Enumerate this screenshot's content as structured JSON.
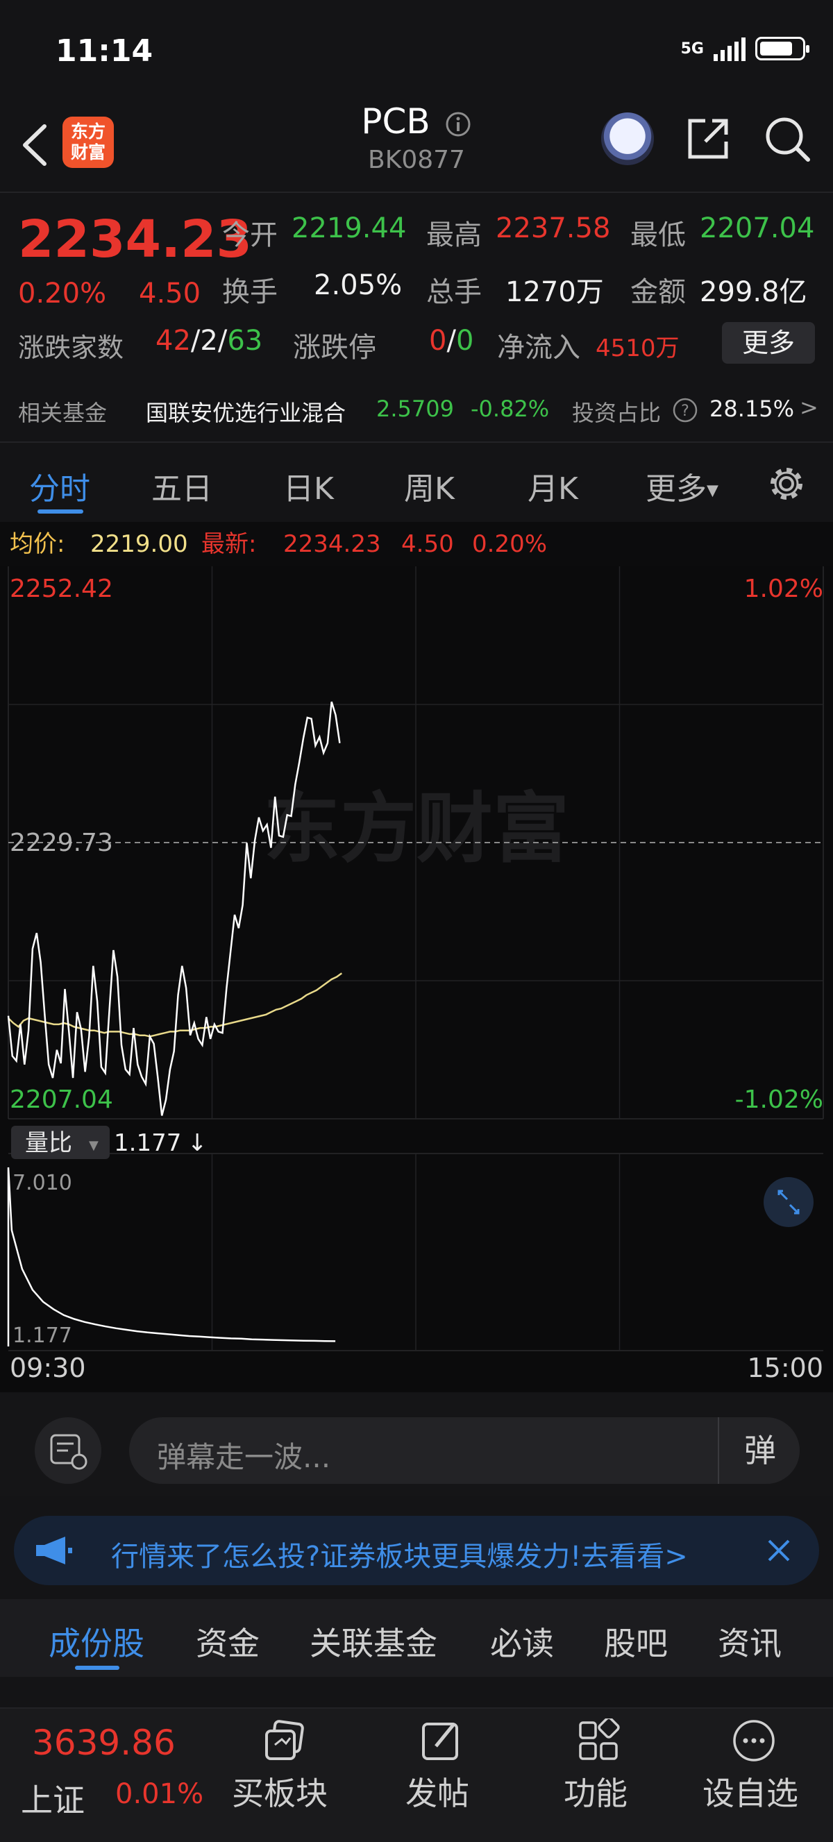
{
  "status": {
    "time": "11:14",
    "network": "5G"
  },
  "header": {
    "logo_text": "东方财富",
    "title": "PCB",
    "subtitle": "BK0877"
  },
  "quote": {
    "price": "2234.23",
    "change_pct": "0.20%",
    "change": "4.50",
    "open_label": "今开",
    "open": "2219.44",
    "high_label": "最高",
    "high": "2237.58",
    "low_label": "最低",
    "low": "2207.04",
    "turnover_label": "换手",
    "turnover": "2.05%",
    "volume_label": "总手",
    "volume": "1270万",
    "amount_label": "金额",
    "amount": "299.8亿",
    "breadth_label": "涨跌家数",
    "breadth_up": "42",
    "breadth_flat": "2",
    "breadth_down": "63",
    "limit_label": "涨跌停",
    "limit_up": "0",
    "limit_down": "0",
    "inflow_label": "净流入",
    "inflow": "4510万",
    "more_label": "更多"
  },
  "fund": {
    "label": "相关基金",
    "name": "国联安优选行业混合",
    "nav": "2.5709",
    "change": "-0.82%",
    "ratio_label": "投资占比",
    "ratio": "28.15%",
    "arrow": ">"
  },
  "tabs": [
    "分时",
    "五日",
    "日K",
    "周K",
    "月K",
    "更多"
  ],
  "avg_row": {
    "avg_label": "均价:",
    "avg": "2219.00",
    "latest_label": "最新:",
    "latest": "2234.23",
    "change": "4.50",
    "change_pct": "0.20%"
  },
  "chart_data": {
    "type": "line",
    "price_axis": {
      "max": "2252.42",
      "mid": "2229.73",
      "min": "2207.04",
      "max_pct": "1.02%",
      "min_pct": "-1.02%"
    },
    "ylim": [
      2207.04,
      2252.42
    ],
    "watermark": "东方财富",
    "series": [
      {
        "name": "最新",
        "values": [
          2215.5,
          2212.2,
          2211.8,
          2214.8,
          2211.5,
          2214.3,
          2221.0,
          2222.3,
          2219.9,
          2215.6,
          2211.5,
          2210.4,
          2212.7,
          2211.6,
          2217.7,
          2214.2,
          2210.4,
          2215.8,
          2214.4,
          2210.9,
          2213.8,
          2219.6,
          2216.7,
          2211.3,
          2210.8,
          2215.9,
          2220.9,
          2218.7,
          2213.1,
          2211.1,
          2210.7,
          2214.5,
          2211.5,
          2210.5,
          2209.9,
          2213.8,
          2213.2,
          2210.4,
          2207.3,
          2208.6,
          2211.1,
          2212.6,
          2217.2,
          2219.6,
          2217.8,
          2213.9,
          2214.9,
          2213.6,
          2213.1,
          2215.4,
          2213.6,
          2214.8,
          2214.2,
          2214.1,
          2217.8,
          2220.8,
          2223.8,
          2222.7,
          2224.6,
          2229.7,
          2226.8,
          2229.9,
          2231.8,
          2230.7,
          2231.2,
          2229.3,
          2233.5,
          2230.3,
          2230.2,
          2232.0,
          2231.9,
          2234.5,
          2236.3,
          2238.3,
          2240.0,
          2239.9,
          2237.7,
          2238.4,
          2237.1,
          2237.9,
          2241.3,
          2240.2,
          2237.9
        ]
      },
      {
        "name": "均价",
        "values": [
          2215.3,
          2214.9,
          2214.6,
          2215.1,
          2215.3,
          2215.2,
          2215.1,
          2215.0,
          2214.9,
          2214.8,
          2214.8,
          2214.9,
          2214.8,
          2214.6,
          2214.5,
          2214.4,
          2214.3,
          2214.3,
          2214.2,
          2214.1,
          2214.2,
          2214.2,
          2214.2,
          2214.1,
          2214.0,
          2214.0,
          2213.9,
          2213.9,
          2213.8,
          2213.9,
          2214.0,
          2214.1,
          2214.2,
          2214.2,
          2214.3,
          2214.3,
          2214.3,
          2214.4,
          2214.5,
          2214.5,
          2214.6,
          2214.6,
          2214.7,
          2214.8,
          2214.9,
          2215.0,
          2215.1,
          2215.2,
          2215.3,
          2215.4,
          2215.5,
          2215.6,
          2215.8,
          2216.0,
          2216.1,
          2216.3,
          2216.5,
          2216.7,
          2216.9,
          2217.2,
          2217.4,
          2217.6,
          2217.9,
          2218.2,
          2218.5,
          2218.7,
          2219.0
        ]
      }
    ],
    "volume_ratio": {
      "label": "量比",
      "value": "1.177",
      "trend": "↓",
      "max": "7.010",
      "current": "1.177",
      "values": [
        7.01,
        4.9,
        3.6,
        2.9,
        2.5,
        2.25,
        2.05,
        1.92,
        1.82,
        1.74,
        1.67,
        1.61,
        1.56,
        1.51,
        1.47,
        1.44,
        1.41,
        1.38,
        1.35,
        1.33,
        1.31,
        1.29,
        1.27,
        1.26,
        1.24,
        1.23,
        1.22,
        1.21,
        1.2,
        1.19,
        1.188,
        1.182,
        1.177
      ]
    },
    "time_start": "09:30",
    "time_end": "15:00"
  },
  "danmu": {
    "placeholder": "弹幕走一波...",
    "button": "弹"
  },
  "banner": {
    "text": "行情来了怎么投?证券板块更具爆发力!去看看>"
  },
  "bottom_tabs": [
    "成份股",
    "资金",
    "关联基金",
    "必读",
    "股吧",
    "资讯"
  ],
  "nav": {
    "index_value": "3639.86",
    "index_name": "上证",
    "index_change": "0.01%",
    "items": [
      "买板块",
      "发帖",
      "功能",
      "设自选"
    ]
  }
}
